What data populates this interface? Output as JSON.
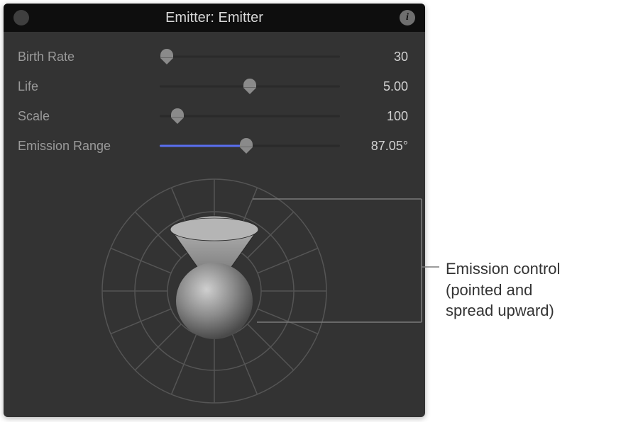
{
  "header": {
    "title": "Emitter: Emitter"
  },
  "params": {
    "birth_rate": {
      "label": "Birth Rate",
      "value": "30",
      "fraction": 0.04,
      "fill": false
    },
    "life": {
      "label": "Life",
      "value": "5.00",
      "fraction": 0.5,
      "fill": false
    },
    "scale": {
      "label": "Scale",
      "value": "100",
      "fraction": 0.1,
      "fill": false
    },
    "emission": {
      "label": "Emission Range",
      "value": "87.05°",
      "fraction": 0.48,
      "fill": true
    }
  },
  "emission_control": {
    "angle_deg": 90,
    "range_deg": 87.05
  },
  "annotation": {
    "line1": "Emission control",
    "line2": "(pointed and",
    "line3": "spread upward)"
  },
  "icons": {
    "info": "i"
  },
  "colors": {
    "accent": "#5a6ff0"
  }
}
